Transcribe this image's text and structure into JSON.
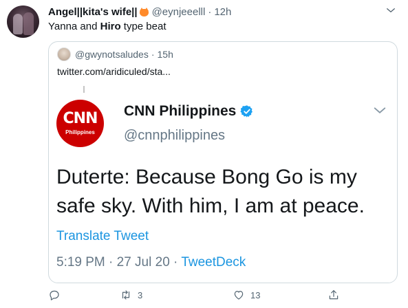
{
  "tweet": {
    "author_name": "Angel||kita's wife||",
    "author_emoji": "fox-face-emoji",
    "handle": "@eynjeeelll",
    "separator": "·",
    "time": "12h",
    "text_before": "Yanna and ",
    "text_bold": "Hiro",
    "text_after": " type beat"
  },
  "quote": {
    "handle": "@gwynotsaludes",
    "separator": "·",
    "time": "15h",
    "link": "twitter.com/aridiculed/sta..."
  },
  "screenshot": {
    "logo_text": "CNN",
    "logo_subtext": "Philippines",
    "account_name": "CNN Philippines",
    "account_handle": "@cnnphilippines",
    "line1": "Duterte: Because Bong Go is my",
    "line2": "safe sky. With him, I am at peace.",
    "translate": "Translate Tweet",
    "meta_time": "5:19 PM · 27 Jul 20 · ",
    "meta_source": "TweetDeck"
  },
  "actions": {
    "retweets": "3",
    "likes": "13"
  },
  "colors": {
    "accent": "#1b95e0",
    "cnn_red": "#cc0000",
    "verified": "#1da1f2"
  }
}
